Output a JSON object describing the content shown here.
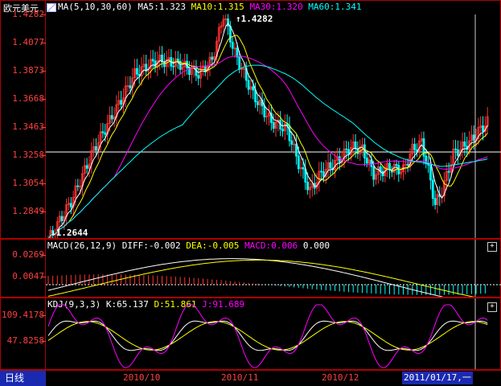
{
  "main": {
    "title": "欧元美元",
    "ma_params": "MA(5,10,30,60)",
    "ma5": "MA5:1.323",
    "ma10": "MA10:1.315",
    "ma30": "MA30:1.320",
    "ma60": "MA60:1.341",
    "yticks": [
      "1.4282",
      "1.4077",
      "1.3873",
      "1.3668",
      "1.3463",
      "1.3258",
      "1.3054",
      "1.2849"
    ],
    "high_label": "1.4282",
    "low_label": "1.2644",
    "colors": {
      "ma5": "#ffffff",
      "ma10": "#ffff00",
      "ma30": "#ff00ff",
      "ma60": "#00ffff",
      "up": "#ff3333",
      "down": "#00ffff"
    }
  },
  "macd": {
    "params": "MACD(26,12,9)",
    "diff": "DIFF:-0.002",
    "dea": "DEA:-0.005",
    "macd": "MACD:0.006",
    "extra": "0.000",
    "yticks": [
      "0.0269",
      "0.0047"
    ],
    "button": "+"
  },
  "kdj": {
    "params": "KDJ(9,3,3)",
    "k": "K:65.137",
    "d": "D:51.861",
    "j": "J:91.689",
    "yticks": [
      "109.4178",
      "47.8258"
    ],
    "button": "+"
  },
  "bottom": {
    "period_tab": "日线",
    "dates": [
      "2010/10",
      "2010/11",
      "2010/12"
    ],
    "cursor_date": "2011/01/17,一"
  }
}
